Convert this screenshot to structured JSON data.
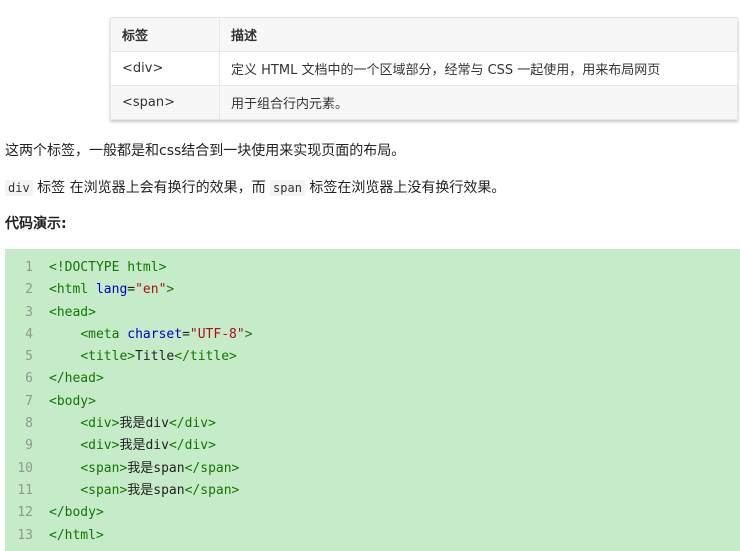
{
  "table": {
    "headers": [
      "标签",
      "描述"
    ],
    "rows": [
      [
        "<div>",
        "定义 HTML 文档中的一个区域部分，经常与 CSS 一起使用，用来布局网页"
      ],
      [
        "<span>",
        "用于组合行内元素。"
      ]
    ]
  },
  "paragraphs": {
    "intro": "这两个标签，一般都是和css结合到一块使用来实现页面的布局。",
    "div_code": "div",
    "middle": "标签 在浏览器上会有换行的效果，而",
    "span_code": "span",
    "end": "标签在浏览器上没有换行效果。",
    "demo_heading": "代码演示:"
  },
  "code": {
    "lines": [
      {
        "n": "1",
        "indent": "",
        "tokens": [
          [
            "tg",
            "<!DOCTYPE html>"
          ]
        ]
      },
      {
        "n": "2",
        "indent": "",
        "tokens": [
          [
            "tg",
            "<html "
          ],
          [
            "at",
            "lang"
          ],
          [
            "tx",
            "="
          ],
          [
            "st",
            "\"en\""
          ],
          [
            "tg",
            ">"
          ]
        ]
      },
      {
        "n": "3",
        "indent": "",
        "tokens": [
          [
            "tg",
            "<head>"
          ]
        ]
      },
      {
        "n": "4",
        "indent": "    ",
        "tokens": [
          [
            "tg",
            "<meta "
          ],
          [
            "at",
            "charset"
          ],
          [
            "tx",
            "="
          ],
          [
            "st",
            "\"UTF-8\""
          ],
          [
            "tg",
            ">"
          ]
        ]
      },
      {
        "n": "5",
        "indent": "    ",
        "tokens": [
          [
            "tg",
            "<title>"
          ],
          [
            "tx",
            "Title"
          ],
          [
            "tg",
            "</title>"
          ]
        ]
      },
      {
        "n": "6",
        "indent": "",
        "tokens": [
          [
            "tg",
            "</head>"
          ]
        ]
      },
      {
        "n": "7",
        "indent": "",
        "tokens": [
          [
            "tg",
            "<body>"
          ]
        ]
      },
      {
        "n": "8",
        "indent": "    ",
        "tokens": [
          [
            "tg",
            "<div>"
          ],
          [
            "tx",
            "我是div"
          ],
          [
            "tg",
            "</div>"
          ]
        ]
      },
      {
        "n": "9",
        "indent": "    ",
        "tokens": [
          [
            "tg",
            "<div>"
          ],
          [
            "tx",
            "我是div"
          ],
          [
            "tg",
            "</div>"
          ]
        ]
      },
      {
        "n": "10",
        "indent": "    ",
        "tokens": [
          [
            "tg",
            "<span>"
          ],
          [
            "tx",
            "我是span"
          ],
          [
            "tg",
            "</span>"
          ]
        ]
      },
      {
        "n": "11",
        "indent": "    ",
        "tokens": [
          [
            "tg",
            "<span>"
          ],
          [
            "tx",
            "我是span"
          ],
          [
            "tg",
            "</span>"
          ]
        ]
      },
      {
        "n": "12",
        "indent": "",
        "tokens": [
          [
            "tg",
            "</body>"
          ]
        ]
      },
      {
        "n": "13",
        "indent": "",
        "tokens": [
          [
            "tg",
            "</html>"
          ]
        ]
      }
    ]
  },
  "colors": {
    "code_background": "#c6ebc9",
    "tag": "#117700",
    "attribute": "#0000cc",
    "string": "#aa1111"
  }
}
